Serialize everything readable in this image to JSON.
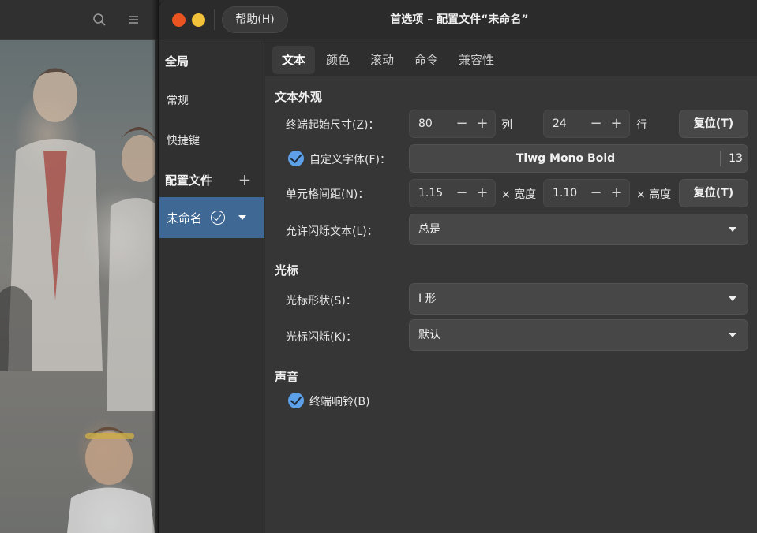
{
  "background_window": {
    "search_icon": "search-icon",
    "menu_icon": "hamburger-menu-icon"
  },
  "titlebar": {
    "help_label": "帮助(H)",
    "title": "首选项 – 配置文件“未命名”",
    "close_color": "#e95420",
    "minimize_color": "#f2c23a"
  },
  "sidebar": {
    "global_header": "全局",
    "items": [
      {
        "label": "常规"
      },
      {
        "label": "快捷键"
      }
    ],
    "profiles_header": "配置文件",
    "add_icon": "plus-icon",
    "profile": {
      "name": "未命名",
      "default_icon": "check-circle-icon",
      "menu_icon": "chevron-down-icon",
      "highlight_color": "#3f6895"
    }
  },
  "tabs": [
    {
      "label": "文本",
      "active": true
    },
    {
      "label": "颜色",
      "active": false
    },
    {
      "label": "滚动",
      "active": false
    },
    {
      "label": "命令",
      "active": false
    },
    {
      "label": "兼容性",
      "active": false
    }
  ],
  "text_section": {
    "title": "文本外观",
    "initial_size": {
      "label": "终端起始尺寸(Z)：",
      "columns": "80",
      "columns_unit": "列",
      "rows": "24",
      "rows_unit": "行",
      "reset_label": "复位(T)"
    },
    "custom_font": {
      "checked": true,
      "label": "自定义字体(F)：",
      "font_name": "Tlwg Mono Bold",
      "font_size": "13"
    },
    "cell_spacing": {
      "label": "单元格间距(N)：",
      "width": "1.15",
      "width_unit": "× 宽度",
      "height": "1.10",
      "height_unit": "× 高度",
      "reset_label": "复位(T)"
    },
    "blink_text": {
      "label": "允许闪烁文本(L)：",
      "value": "总是"
    }
  },
  "cursor_section": {
    "title": "光标",
    "shape": {
      "label": "光标形状(S)：",
      "value": "I 形"
    },
    "blink": {
      "label": "光标闪烁(K)：",
      "value": "默认"
    }
  },
  "sound_section": {
    "title": "声音",
    "bell": {
      "checked": true,
      "label": "终端响铃(B)"
    }
  },
  "spin_symbols": {
    "minus": "−",
    "plus": "+"
  },
  "accent_color": "#5ea0e8"
}
